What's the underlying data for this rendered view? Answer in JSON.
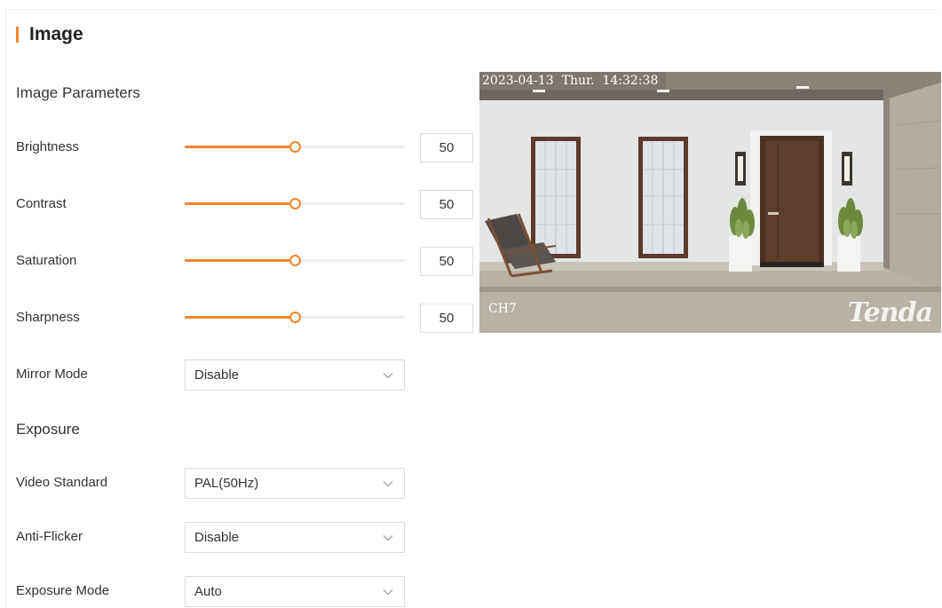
{
  "page": {
    "title": "Image"
  },
  "sections": {
    "image_parameters": "Image Parameters",
    "exposure": "Exposure"
  },
  "sliders": [
    {
      "label": "Brightness",
      "value": "50",
      "level": 0.5
    },
    {
      "label": "Contrast",
      "value": "50",
      "level": 0.5
    },
    {
      "label": "Saturation",
      "value": "50",
      "level": 0.5
    },
    {
      "label": "Sharpness",
      "value": "50",
      "level": 0.5
    }
  ],
  "mirror_mode": {
    "label": "Mirror Mode",
    "value": "Disable"
  },
  "video_standard": {
    "label": "Video Standard",
    "value": "PAL(50Hz)"
  },
  "anti_flicker": {
    "label": "Anti-Flicker",
    "value": "Disable"
  },
  "exposure_mode": {
    "label": "Exposure Mode",
    "value": "Auto"
  },
  "preview": {
    "timestamp": "2023-04-13  Thur.  14:32:38",
    "channel": "CH7",
    "logo": "Tenda"
  },
  "icons": {
    "dropdown": "chevron-down-icon"
  },
  "colors": {
    "accent": "#f5852a",
    "text": "#333333",
    "border": "#dcdcdc",
    "track": "#eeeeee"
  }
}
